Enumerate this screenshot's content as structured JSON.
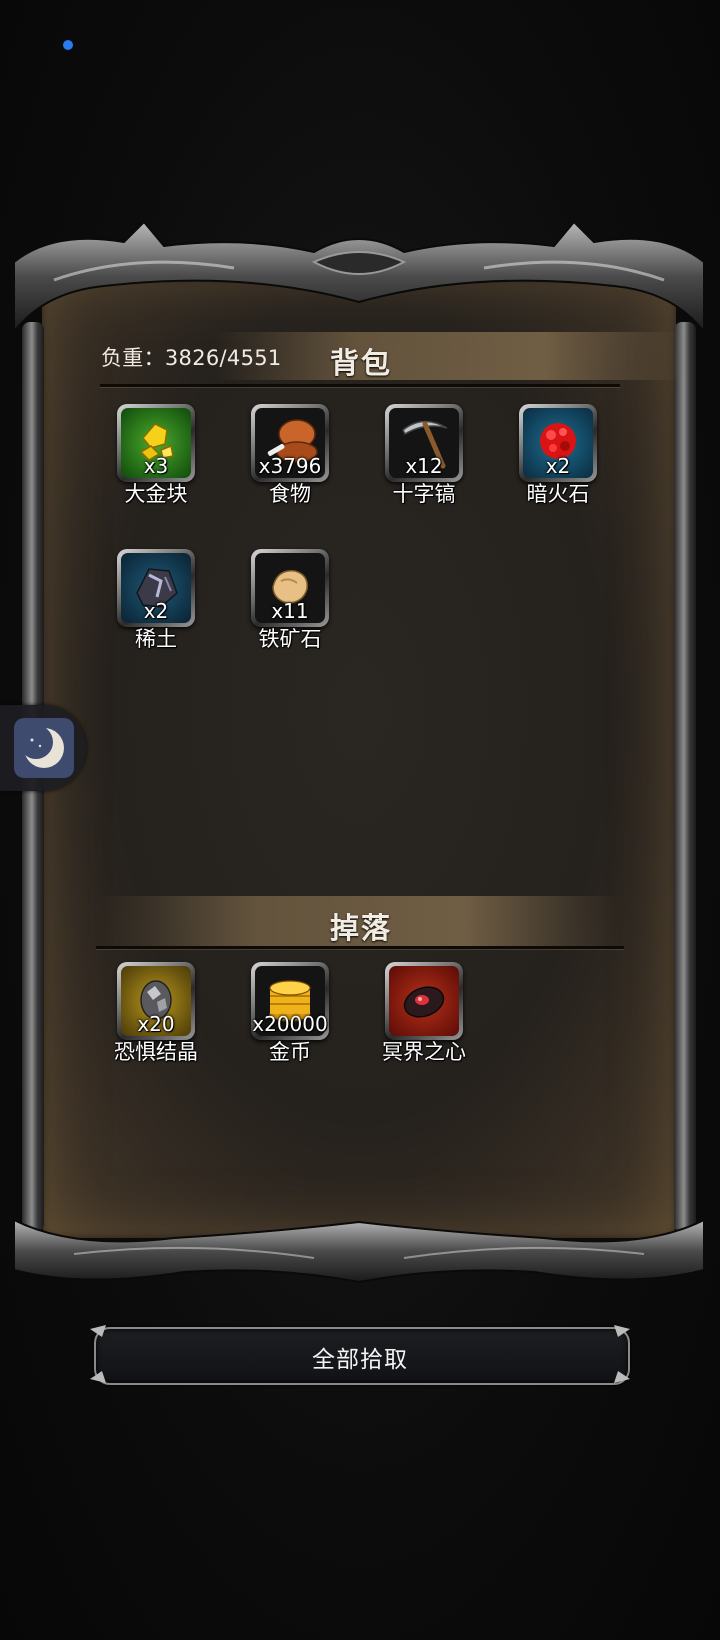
{
  "bag": {
    "load_text": "负重：3826/4551",
    "title": "背包",
    "items": [
      {
        "name": "大金块",
        "count": "x3",
        "icon": "gold-nugget-icon",
        "bg": "#1e6a1a"
      },
      {
        "name": "食物",
        "count": "x3796",
        "icon": "meat-drumstick-icon",
        "bg": "#151515"
      },
      {
        "name": "十字镐",
        "count": "x12",
        "icon": "pickaxe-icon",
        "bg": "#151515"
      },
      {
        "name": "暗火石",
        "count": "x2",
        "icon": "red-ore-icon",
        "bg": "#124a66"
      },
      {
        "name": "稀土",
        "count": "x2",
        "icon": "dark-ore-icon",
        "bg": "#124a66"
      },
      {
        "name": "铁矿石",
        "count": "x11",
        "icon": "iron-ore-icon",
        "bg": "#151515"
      }
    ]
  },
  "drops": {
    "title": "掉落",
    "items": [
      {
        "name": "恐惧结晶",
        "count": "x20",
        "icon": "crystal-egg-icon",
        "bg": "#6a5a14"
      },
      {
        "name": "金币",
        "count": "x20000",
        "icon": "gold-coins-icon",
        "bg": "#151515"
      },
      {
        "name": "冥界之心",
        "count": "",
        "icon": "netherworld-heart-icon",
        "bg": "#8a1c10"
      }
    ]
  },
  "pickup_button": {
    "label": "全部拾取"
  },
  "floating": {
    "icon": "moon-icon"
  }
}
